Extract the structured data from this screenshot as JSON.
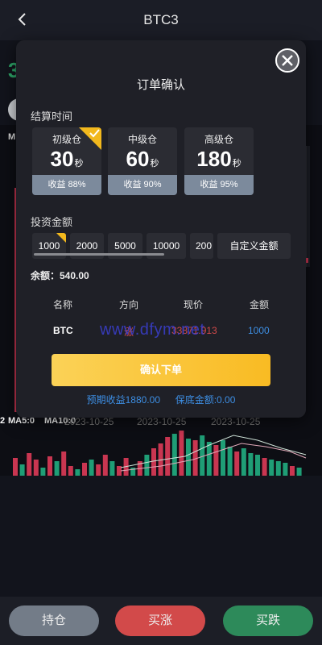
{
  "header": {
    "title": "BTC3"
  },
  "background": {
    "price_digit": "3",
    "ma_label": "M",
    "ma5": "MA5:0",
    "ma10": "MA10:0",
    "ma_date_prefix_digit": "2",
    "dates": [
      "2023-10-25",
      "2023-10-25",
      "2023-10-25"
    ]
  },
  "modal": {
    "title": "订单确认",
    "settle_label": "结算时间",
    "tiers": [
      {
        "name": "初级仓",
        "seconds": "30",
        "unit": "秒",
        "gain": "收益 88%",
        "selected": true
      },
      {
        "name": "中级仓",
        "seconds": "60",
        "unit": "秒",
        "gain": "收益 90%",
        "selected": false
      },
      {
        "name": "高级仓",
        "seconds": "180",
        "unit": "秒",
        "gain": "收益 95%",
        "selected": false
      }
    ],
    "amount_label": "投资金额",
    "amounts": [
      "1000",
      "2000",
      "5000",
      "10000",
      "200"
    ],
    "custom_amount": "自定义金额",
    "balance": "余额：540.00",
    "table_headers": [
      "名称",
      "方向",
      "现价",
      "金额"
    ],
    "row": {
      "name": "BTC",
      "direction": "涨",
      "price": "33871.913",
      "amount": "1000"
    },
    "watermark": "www.dfym.net",
    "confirm_label": "确认下单",
    "expected_gain": "预期收益1880.00",
    "margin": "保底金额:0.00"
  },
  "bottom": {
    "hold": "持仓",
    "buy_up": "买涨",
    "buy_down": "买跌"
  },
  "colors": {
    "accent": "#f9bb23",
    "up": "#d24a4a",
    "down": "#2d8a5a",
    "blue": "#3d8ee3"
  }
}
